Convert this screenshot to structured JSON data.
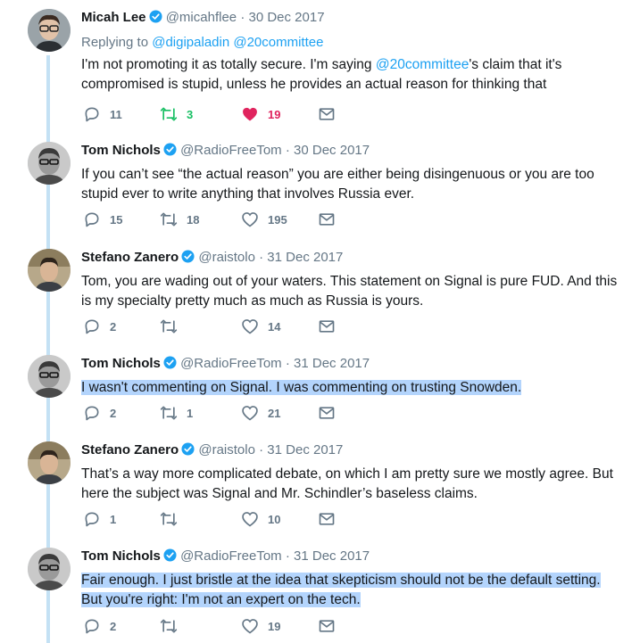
{
  "tweets": [
    {
      "author": "Micah Lee",
      "handle": "@micahflee",
      "date": "30 Dec 2017",
      "replying_to": {
        "prefix": "Replying to ",
        "mentions": [
          "@digipaladin",
          "@20committee"
        ]
      },
      "text_parts": [
        {
          "t": "I'm not promoting it as totally secure. I'm saying "
        },
        {
          "t": "@20committee",
          "link": true
        },
        {
          "t": "'s claim that it's compromised is stupid, unless he provides an actual reason for thinking that"
        }
      ],
      "replies": "11",
      "retweets": "3",
      "likes": "19",
      "retweeted": true,
      "liked": true
    },
    {
      "author": "Tom Nichols",
      "handle": "@RadioFreeTom",
      "date": "30 Dec 2017",
      "text_parts": [
        {
          "t": "If you can’t see “the actual reason” you are either being disingenuous or you are too stupid ever to write anything that involves Russia ever."
        }
      ],
      "replies": "15",
      "retweets": "18",
      "likes": "195",
      "retweeted": false,
      "liked": false
    },
    {
      "author": "Stefano Zanero",
      "handle": "@raistolo",
      "date": "31 Dec 2017",
      "text_parts": [
        {
          "t": "Tom, you are wading out of your waters. This statement on Signal is pure FUD. And this is my specialty pretty much as much as Russia is yours."
        }
      ],
      "replies": "2",
      "retweets": "",
      "likes": "14",
      "retweeted": false,
      "liked": false
    },
    {
      "author": "Tom Nichols",
      "handle": "@RadioFreeTom",
      "date": "31 Dec 2017",
      "text_parts": [
        {
          "t": "I wasn't commenting on Signal. I was commenting on trusting Snowden.",
          "highlight": true
        }
      ],
      "replies": "2",
      "retweets": "1",
      "likes": "21",
      "retweeted": false,
      "liked": false
    },
    {
      "author": "Stefano Zanero",
      "handle": "@raistolo",
      "date": "31 Dec 2017",
      "text_parts": [
        {
          "t": "That’s a way more complicated debate, on which I am pretty sure we mostly agree. But here the subject was Signal and Mr. Schindler’s baseless claims."
        }
      ],
      "replies": "1",
      "retweets": "",
      "likes": "10",
      "retweeted": false,
      "liked": false
    },
    {
      "author": "Tom Nichols",
      "handle": "@RadioFreeTom",
      "date": "31 Dec 2017",
      "text_parts": [
        {
          "t": "Fair enough. I just bristle at the idea that skepticism should not be the default setting. But you're right: I'm not an expert on the tech.",
          "highlight": true
        }
      ],
      "replies": "2",
      "retweets": "",
      "likes": "19",
      "retweeted": false,
      "liked": false
    }
  ],
  "separator": "·",
  "colors": {
    "link": "#1da1f2",
    "muted": "#657786",
    "retweet_active": "#17bf63",
    "like_active": "#e0245e",
    "thread_line": "#c4e1f4",
    "highlight": "#b3d4fc"
  },
  "icons": {
    "reply": "reply-icon",
    "retweet": "retweet-icon",
    "like": "heart-icon",
    "message": "envelope-icon",
    "verified": "verified-badge-icon"
  }
}
